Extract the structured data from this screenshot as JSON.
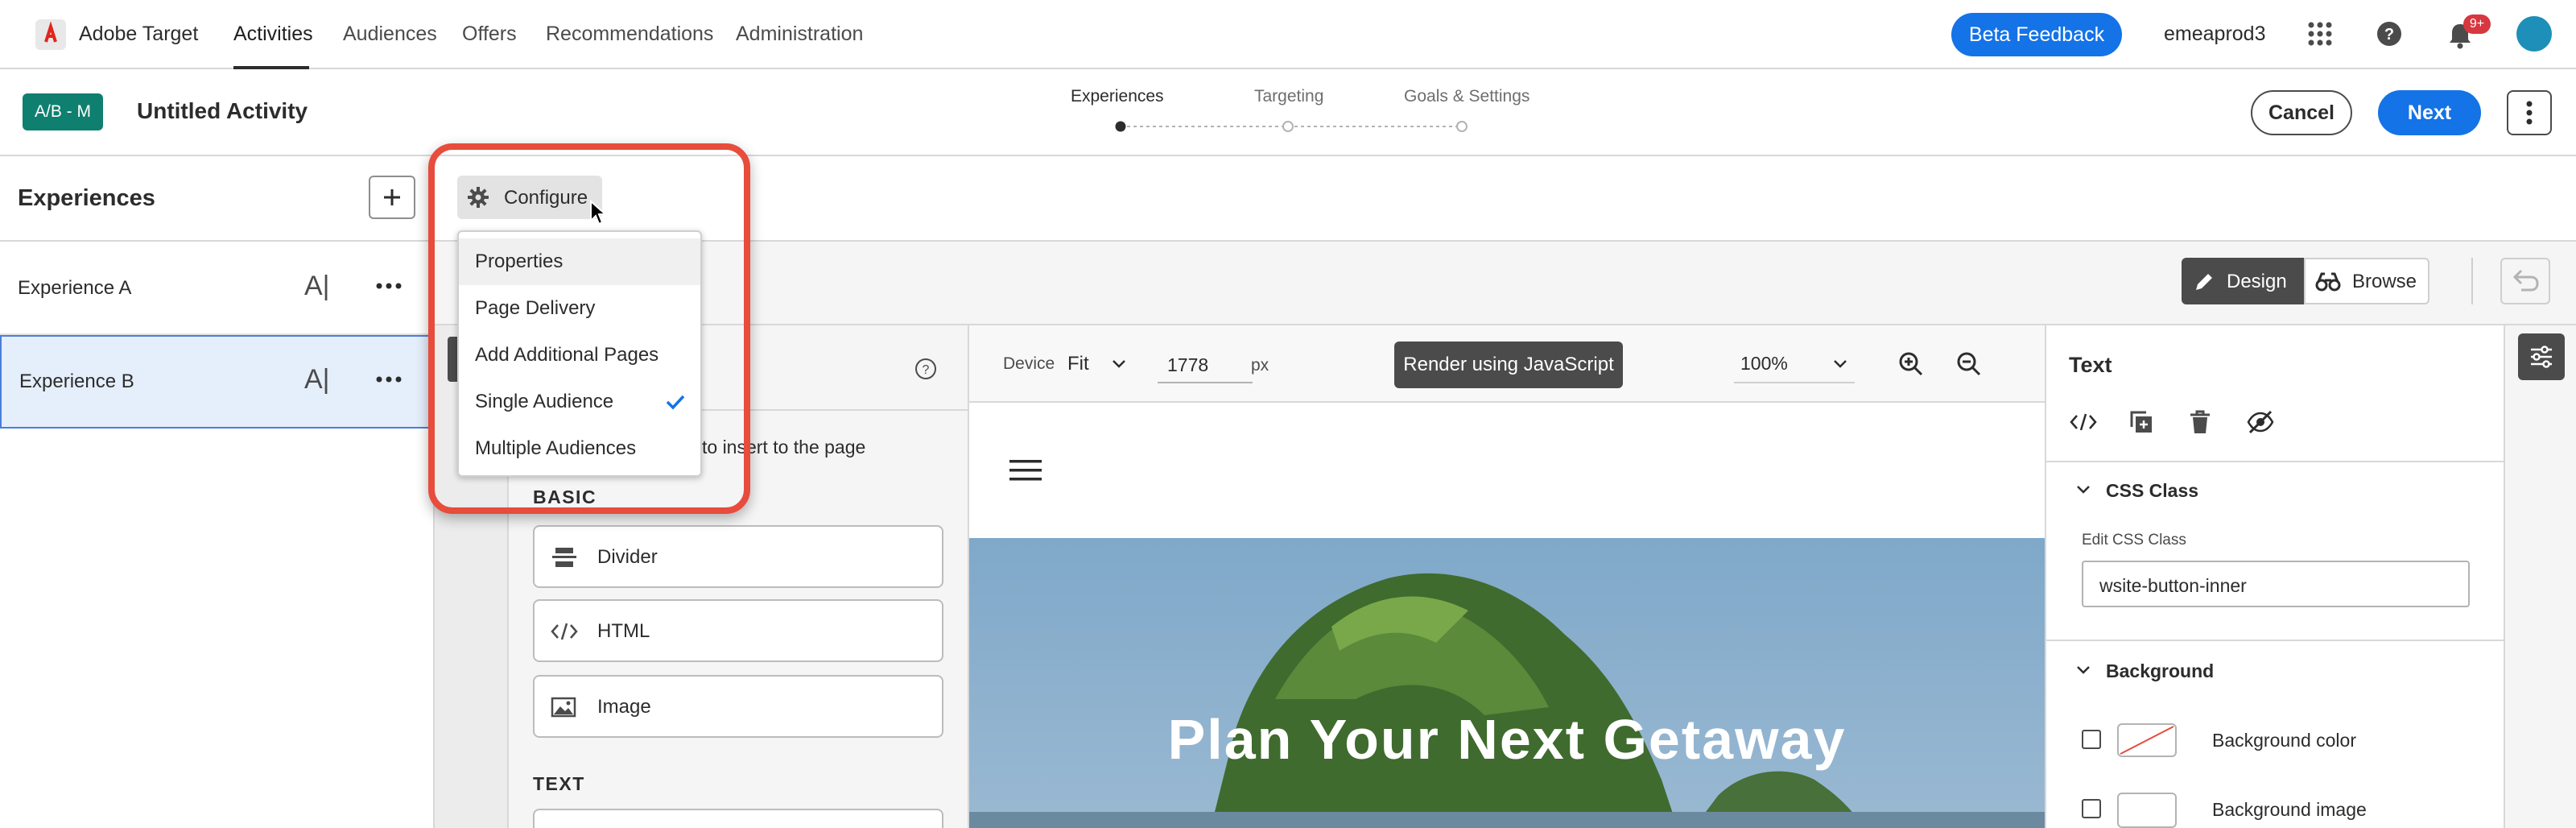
{
  "nav": {
    "brand": "Adobe Target",
    "items": [
      "Activities",
      "Audiences",
      "Offers",
      "Recommendations",
      "Administration"
    ],
    "feedback": "Beta Feedback",
    "org": "emeaprod3",
    "notif_badge": "9+"
  },
  "activity": {
    "badge": "A/B - M",
    "title": "Untitled Activity",
    "steps": [
      "Experiences",
      "Targeting",
      "Goals & Settings"
    ],
    "cancel": "Cancel",
    "next": "Next"
  },
  "experiences": {
    "heading": "Experiences",
    "items": [
      {
        "label": "Experience A",
        "ai": "A|"
      },
      {
        "label": "Experience B",
        "ai": "A|"
      }
    ]
  },
  "configure": {
    "label": "Configure",
    "menu": [
      "Properties",
      "Page Delivery",
      "Add Additional Pages",
      "Single Audience",
      "Multiple Audiences"
    ]
  },
  "mode": {
    "design": "Design",
    "browse": "Browse"
  },
  "components": {
    "hint": "to insert to the page",
    "basic_heading": "BASIC",
    "basic": [
      "Divider",
      "HTML",
      "Image"
    ],
    "text_heading": "TEXT"
  },
  "preview": {
    "device_label": "Device",
    "device_value": "Fit",
    "width": "1778",
    "unit": "px",
    "render": "Render using JavaScript",
    "zoom": "100%",
    "hero_text": "Plan Your Next Getaway"
  },
  "inspector": {
    "title": "Text",
    "css_section": "CSS Class",
    "css_field_label": "Edit CSS Class",
    "css_value": "wsite-button-inner",
    "bg_section": "Background",
    "bg_color": "Background color",
    "bg_image": "Background image"
  },
  "colors": {
    "accent": "#1473e6",
    "badge_teal": "#0f7f6f",
    "highlight": "#e74c3c",
    "notif": "#d7373f"
  }
}
